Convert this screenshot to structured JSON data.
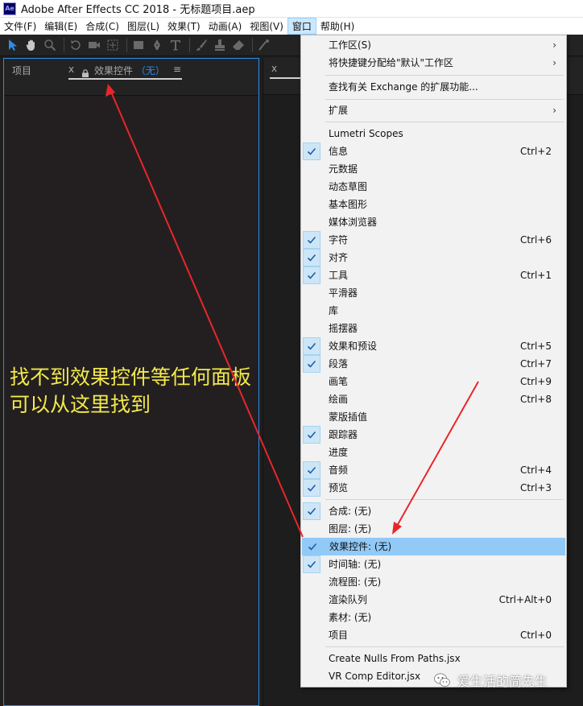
{
  "window": {
    "title": "Adobe After Effects CC 2018 - 无标题项目.aep",
    "app_icon_text": "Ae"
  },
  "menubar": {
    "items": [
      "文件(F)",
      "编辑(E)",
      "合成(C)",
      "图层(L)",
      "效果(T)",
      "动画(A)",
      "视图(V)",
      "窗口",
      "帮助(H)"
    ],
    "active": "窗口"
  },
  "left_panel": {
    "tab_project": "项目",
    "tab_close": "x",
    "tab_effects_title": "效果控件",
    "tab_effects_value": "（无）",
    "tab_menu": "≡"
  },
  "right_panel": {
    "tab_close": "x"
  },
  "annotation": {
    "line1": "找不到效果控件等任何面板",
    "line2": "可以从这里找到"
  },
  "window_menu": {
    "items": [
      {
        "label": "工作区(S)",
        "shortcut": "",
        "checked": false,
        "submenu": true
      },
      {
        "label": "将快捷键分配给\"默认\"工作区",
        "shortcut": "",
        "checked": false,
        "submenu": true
      },
      {
        "label": "查找有关 Exchange 的扩展功能...",
        "shortcut": "",
        "checked": false
      },
      {
        "label": "扩展",
        "shortcut": "",
        "checked": false,
        "submenu": true
      },
      {
        "label": "Lumetri Scopes",
        "shortcut": "",
        "checked": false
      },
      {
        "label": "信息",
        "shortcut": "Ctrl+2",
        "checked": true
      },
      {
        "label": "元数据",
        "shortcut": "",
        "checked": false
      },
      {
        "label": "动态草图",
        "shortcut": "",
        "checked": false
      },
      {
        "label": "基本图形",
        "shortcut": "",
        "checked": false
      },
      {
        "label": "媒体浏览器",
        "shortcut": "",
        "checked": false
      },
      {
        "label": "字符",
        "shortcut": "Ctrl+6",
        "checked": true
      },
      {
        "label": "对齐",
        "shortcut": "",
        "checked": true
      },
      {
        "label": "工具",
        "shortcut": "Ctrl+1",
        "checked": true
      },
      {
        "label": "平滑器",
        "shortcut": "",
        "checked": false
      },
      {
        "label": "库",
        "shortcut": "",
        "checked": false
      },
      {
        "label": "摇摆器",
        "shortcut": "",
        "checked": false
      },
      {
        "label": "效果和预设",
        "shortcut": "Ctrl+5",
        "checked": true
      },
      {
        "label": "段落",
        "shortcut": "Ctrl+7",
        "checked": true
      },
      {
        "label": "画笔",
        "shortcut": "Ctrl+9",
        "checked": false
      },
      {
        "label": "绘画",
        "shortcut": "Ctrl+8",
        "checked": false
      },
      {
        "label": "蒙版插值",
        "shortcut": "",
        "checked": false
      },
      {
        "label": "跟踪器",
        "shortcut": "",
        "checked": true
      },
      {
        "label": "进度",
        "shortcut": "",
        "checked": false
      },
      {
        "label": "音频",
        "shortcut": "Ctrl+4",
        "checked": true
      },
      {
        "label": "预览",
        "shortcut": "Ctrl+3",
        "checked": true
      },
      {
        "label": "合成: (无)",
        "shortcut": "",
        "checked": true
      },
      {
        "label": "图层: (无)",
        "shortcut": "",
        "checked": false
      },
      {
        "label": "效果控件: (无)",
        "shortcut": "",
        "checked": true,
        "highlighted": true
      },
      {
        "label": "时间轴: (无)",
        "shortcut": "",
        "checked": true
      },
      {
        "label": "流程图: (无)",
        "shortcut": "",
        "checked": false
      },
      {
        "label": "渲染队列",
        "shortcut": "Ctrl+Alt+0",
        "checked": false
      },
      {
        "label": "素材: (无)",
        "shortcut": "",
        "checked": false
      },
      {
        "label": "项目",
        "shortcut": "Ctrl+0",
        "checked": false
      },
      {
        "label": "Create Nulls From Paths.jsx",
        "shortcut": "",
        "checked": false
      },
      {
        "label": "VR Comp Editor.jsx",
        "shortcut": "",
        "checked": false
      }
    ]
  },
  "watermark": {
    "text": "爱生活的简先生",
    "icon": "wechat-icon"
  },
  "colors": {
    "accent_blue": "#2d8ceb",
    "menu_highlight": "#91c9f7",
    "annotation_yellow": "#f3e94a",
    "arrow_red": "#e8262a"
  }
}
